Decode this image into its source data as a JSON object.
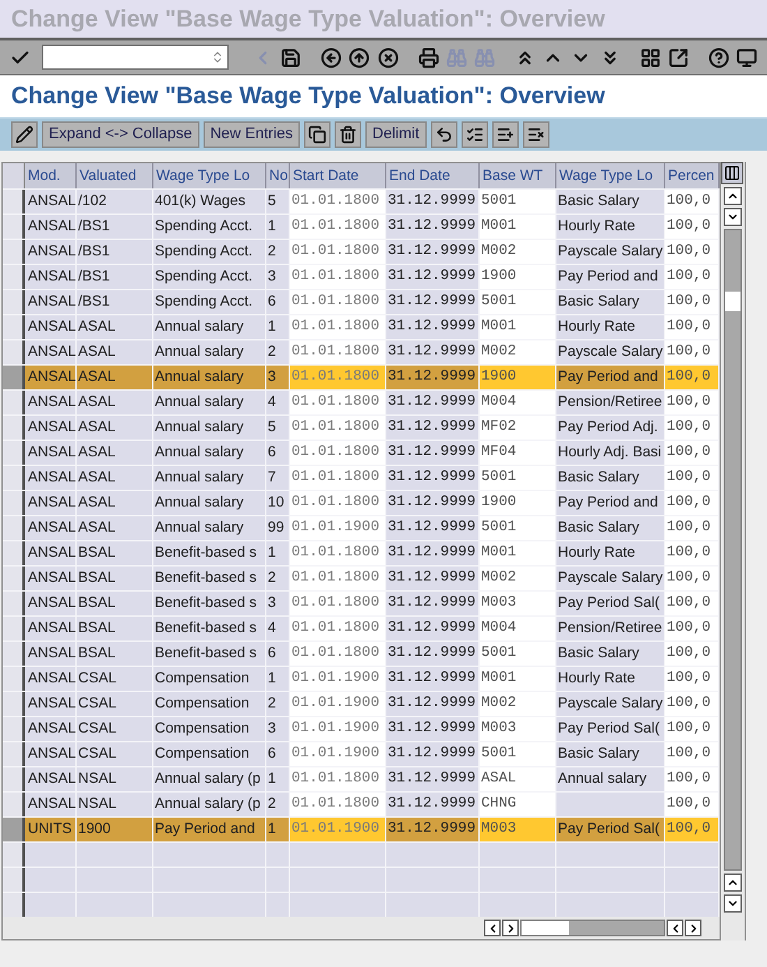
{
  "window": {
    "title": "Change View \"Base Wage Type Valuation\": Overview"
  },
  "screen_title": "Change View \"Base Wage Type Valuation\": Overview",
  "app_toolbar": [
    {
      "kind": "icon"
    },
    {
      "kind": "text",
      "label": "Expand <-> Collapse"
    },
    {
      "kind": "text",
      "label": "New Entries"
    },
    {
      "kind": "icon"
    },
    {
      "kind": "icon"
    },
    {
      "kind": "text",
      "label": "Delimit"
    },
    {
      "kind": "icon"
    },
    {
      "kind": "icon"
    },
    {
      "kind": "icon"
    },
    {
      "kind": "icon"
    }
  ],
  "table": {
    "columns": [
      "Mod.",
      "Valuated",
      "Wage Type Lo",
      "No",
      "Start Date",
      "End Date",
      "Base WT",
      "Wage Type Lo",
      "Percen"
    ],
    "rows": [
      {
        "cells": [
          "ANSAL",
          "/102",
          "401(k) Wages",
          "5",
          "01.01.1800",
          "31.12.9999",
          "5001",
          "Basic Salary",
          "100,0"
        ],
        "selected": false
      },
      {
        "cells": [
          "ANSAL",
          "/BS1",
          "Spending Acct.",
          "1",
          "01.01.1800",
          "31.12.9999",
          "M001",
          "Hourly Rate",
          "100,0"
        ],
        "selected": false
      },
      {
        "cells": [
          "ANSAL",
          "/BS1",
          "Spending Acct.",
          "2",
          "01.01.1800",
          "31.12.9999",
          "M002",
          "Payscale Salary",
          "100,0"
        ],
        "selected": false
      },
      {
        "cells": [
          "ANSAL",
          "/BS1",
          "Spending Acct.",
          "3",
          "01.01.1800",
          "31.12.9999",
          "1900",
          "Pay Period and",
          "100,0"
        ],
        "selected": false
      },
      {
        "cells": [
          "ANSAL",
          "/BS1",
          "Spending Acct.",
          "6",
          "01.01.1800",
          "31.12.9999",
          "5001",
          "Basic Salary",
          "100,0"
        ],
        "selected": false
      },
      {
        "cells": [
          "ANSAL",
          "ASAL",
          "Annual salary",
          "1",
          "01.01.1800",
          "31.12.9999",
          "M001",
          "Hourly Rate",
          "100,0"
        ],
        "selected": false
      },
      {
        "cells": [
          "ANSAL",
          "ASAL",
          "Annual salary",
          "2",
          "01.01.1800",
          "31.12.9999",
          "M002",
          "Payscale Salary",
          "100,0"
        ],
        "selected": false
      },
      {
        "cells": [
          "ANSAL",
          "ASAL",
          "Annual salary",
          "3",
          "01.01.1800",
          "31.12.9999",
          "1900",
          "Pay Period and",
          "100,0"
        ],
        "selected": true
      },
      {
        "cells": [
          "ANSAL",
          "ASAL",
          "Annual salary",
          "4",
          "01.01.1800",
          "31.12.9999",
          "M004",
          "Pension/Retiree",
          "100,0"
        ],
        "selected": false
      },
      {
        "cells": [
          "ANSAL",
          "ASAL",
          "Annual salary",
          "5",
          "01.01.1800",
          "31.12.9999",
          "MF02",
          "Pay Period Adj.",
          "100,0"
        ],
        "selected": false
      },
      {
        "cells": [
          "ANSAL",
          "ASAL",
          "Annual salary",
          "6",
          "01.01.1800",
          "31.12.9999",
          "MF04",
          "Hourly Adj. Basi",
          "100,0"
        ],
        "selected": false
      },
      {
        "cells": [
          "ANSAL",
          "ASAL",
          "Annual salary",
          "7",
          "01.01.1800",
          "31.12.9999",
          "5001",
          "Basic Salary",
          "100,0"
        ],
        "selected": false
      },
      {
        "cells": [
          "ANSAL",
          "ASAL",
          "Annual salary",
          "10",
          "01.01.1800",
          "31.12.9999",
          "1900",
          "Pay Period and",
          "100,0"
        ],
        "selected": false
      },
      {
        "cells": [
          "ANSAL",
          "ASAL",
          "Annual salary",
          "99",
          "01.01.1900",
          "31.12.9999",
          "5001",
          "Basic Salary",
          "100,0"
        ],
        "selected": false
      },
      {
        "cells": [
          "ANSAL",
          "BSAL",
          "Benefit-based s",
          "1",
          "01.01.1800",
          "31.12.9999",
          "M001",
          "Hourly Rate",
          "100,0"
        ],
        "selected": false
      },
      {
        "cells": [
          "ANSAL",
          "BSAL",
          "Benefit-based s",
          "2",
          "01.01.1800",
          "31.12.9999",
          "M002",
          "Payscale Salary",
          "100,0"
        ],
        "selected": false
      },
      {
        "cells": [
          "ANSAL",
          "BSAL",
          "Benefit-based s",
          "3",
          "01.01.1800",
          "31.12.9999",
          "M003",
          "Pay Period Sal(",
          "100,0"
        ],
        "selected": false
      },
      {
        "cells": [
          "ANSAL",
          "BSAL",
          "Benefit-based s",
          "4",
          "01.01.1800",
          "31.12.9999",
          "M004",
          "Pension/Retiree",
          "100,0"
        ],
        "selected": false
      },
      {
        "cells": [
          "ANSAL",
          "BSAL",
          "Benefit-based s",
          "6",
          "01.01.1800",
          "31.12.9999",
          "5001",
          "Basic Salary",
          "100,0"
        ],
        "selected": false
      },
      {
        "cells": [
          "ANSAL",
          "CSAL",
          "Compensation",
          "1",
          "01.01.1900",
          "31.12.9999",
          "M001",
          "Hourly Rate",
          "100,0"
        ],
        "selected": false
      },
      {
        "cells": [
          "ANSAL",
          "CSAL",
          "Compensation",
          "2",
          "01.01.1900",
          "31.12.9999",
          "M002",
          "Payscale Salary",
          "100,0"
        ],
        "selected": false
      },
      {
        "cells": [
          "ANSAL",
          "CSAL",
          "Compensation",
          "3",
          "01.01.1900",
          "31.12.9999",
          "M003",
          "Pay Period Sal(",
          "100,0"
        ],
        "selected": false
      },
      {
        "cells": [
          "ANSAL",
          "CSAL",
          "Compensation",
          "6",
          "01.01.1900",
          "31.12.9999",
          "5001",
          "Basic Salary",
          "100,0"
        ],
        "selected": false
      },
      {
        "cells": [
          "ANSAL",
          "NSAL",
          "Annual salary (p",
          "1",
          "01.01.1800",
          "31.12.9999",
          "ASAL",
          "Annual salary",
          "100,0"
        ],
        "selected": false
      },
      {
        "cells": [
          "ANSAL",
          "NSAL",
          "Annual salary (p",
          "2",
          "01.01.1800",
          "31.12.9999",
          "CHNG",
          "",
          "100,0"
        ],
        "selected": false
      },
      {
        "cells": [
          "UNITS",
          "1900",
          "Pay Period and",
          "1",
          "01.01.1900",
          "31.12.9999",
          "M003",
          "Pay Period Sal(",
          "100,0"
        ],
        "selected": true
      }
    ]
  }
}
